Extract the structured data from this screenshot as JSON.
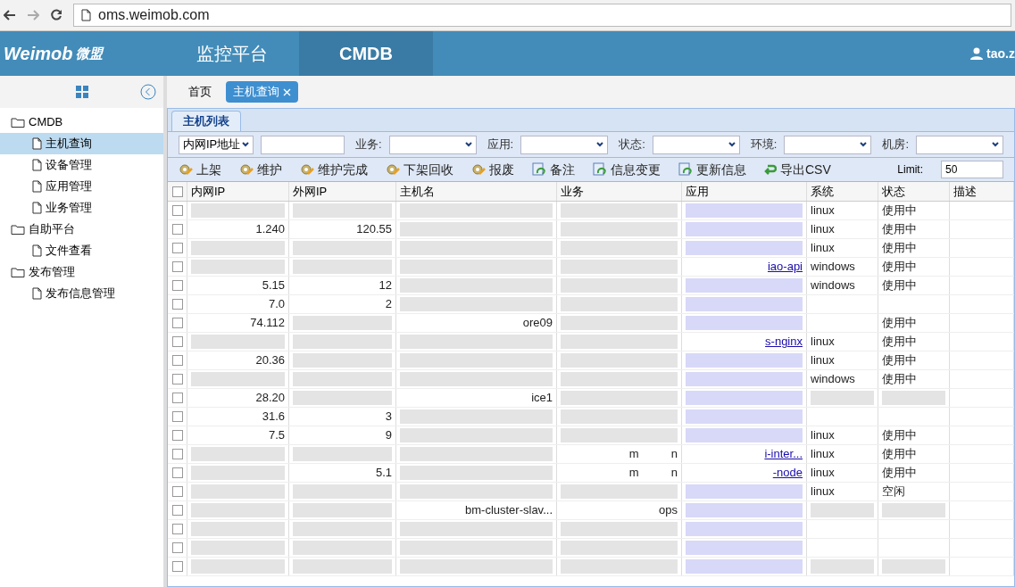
{
  "browser": {
    "url": "oms.weimob.com"
  },
  "header": {
    "logo": "Weimob",
    "logo_cn": "微盟",
    "nav": [
      {
        "label": "监控平台",
        "selected": false
      },
      {
        "label": "CMDB",
        "selected": true
      }
    ],
    "user": "tao.z"
  },
  "sidebar": {
    "items": [
      {
        "label": "CMDB",
        "expanded": true,
        "children": [
          {
            "label": "主机查询",
            "selected": true
          },
          {
            "label": "设备管理",
            "selected": false
          },
          {
            "label": "应用管理",
            "selected": false
          },
          {
            "label": "业务管理",
            "selected": false
          }
        ]
      },
      {
        "label": "自助平台",
        "expanded": true,
        "children": [
          {
            "label": "文件查看",
            "selected": false
          }
        ]
      },
      {
        "label": "发布管理",
        "expanded": true,
        "children": [
          {
            "label": "发布信息管理",
            "selected": false
          }
        ]
      }
    ]
  },
  "page_tabs": [
    {
      "label": "首页",
      "selected": false,
      "closable": false
    },
    {
      "label": "主机查询",
      "selected": true,
      "closable": true
    }
  ],
  "panel_title": "主机列表",
  "filters": {
    "ip_select": "内网IP地址",
    "fields": [
      {
        "label": "业务:"
      },
      {
        "label": "应用:"
      },
      {
        "label": "状态:"
      },
      {
        "label": "环境:"
      },
      {
        "label": "机房:"
      }
    ]
  },
  "actions": [
    {
      "label": "上架",
      "kind": "gear"
    },
    {
      "label": "维护",
      "kind": "gear"
    },
    {
      "label": "维护完成",
      "kind": "gear"
    },
    {
      "label": "下架回收",
      "kind": "gear"
    },
    {
      "label": "报废",
      "kind": "gear"
    },
    {
      "label": "备注",
      "kind": "edit"
    },
    {
      "label": "信息变更",
      "kind": "edit"
    },
    {
      "label": "更新信息",
      "kind": "edit"
    },
    {
      "label": "导出CSV",
      "kind": "export"
    }
  ],
  "limit": {
    "label": "Limit:",
    "value": "50"
  },
  "table": {
    "all_checked": false,
    "columns": [
      "内网IP",
      "外网IP",
      "主机名",
      "业务",
      "应用",
      "系统",
      "状态",
      "描述"
    ],
    "rows": [
      {
        "checked": false,
        "system": "linux",
        "status": "使用中"
      },
      {
        "checked": false,
        "inner_ip": "1.240",
        "outer_ip": "120.55",
        "system": "linux",
        "status": "使用中"
      },
      {
        "checked": false,
        "system": "linux",
        "status": "使用中"
      },
      {
        "checked": false,
        "app": "iao-api",
        "system": "windows",
        "status": "使用中"
      },
      {
        "checked": false,
        "inner_ip": "5.15",
        "outer_ip": "12",
        "system": "windows",
        "status": "使用中"
      },
      {
        "checked": false,
        "inner_ip": "7.0",
        "outer_ip": "2"
      },
      {
        "checked": false,
        "inner_ip": "74.112",
        "host": "ore09",
        "status": "使用中"
      },
      {
        "checked": false,
        "app": "s-nginx",
        "system": "linux",
        "status": "使用中"
      },
      {
        "checked": false,
        "inner_ip": "20.36",
        "system": "linux",
        "status": "使用中"
      },
      {
        "checked": false,
        "system": "windows",
        "status": "使用中"
      },
      {
        "checked": false,
        "inner_ip": "28.20",
        "host": "ice1"
      },
      {
        "checked": false,
        "inner_ip": "31.6",
        "outer_ip": "3"
      },
      {
        "checked": false,
        "inner_ip": "7.5",
        "outer_ip": "9",
        "system": "linux",
        "status": "使用中"
      },
      {
        "checked": false,
        "business": "m          n",
        "app": "i-inter...",
        "system": "linux",
        "status": "使用中"
      },
      {
        "checked": false,
        "outer_ip": "5.1",
        "business": "m          n",
        "app": "-node",
        "system": "linux",
        "status": "使用中"
      },
      {
        "checked": false,
        "system": "linux",
        "status": "空闲"
      },
      {
        "checked": false,
        "host": "bm-cluster-slav...",
        "business": "ops"
      },
      {
        "checked": false
      },
      {
        "checked": false
      },
      {
        "checked": false
      }
    ]
  }
}
